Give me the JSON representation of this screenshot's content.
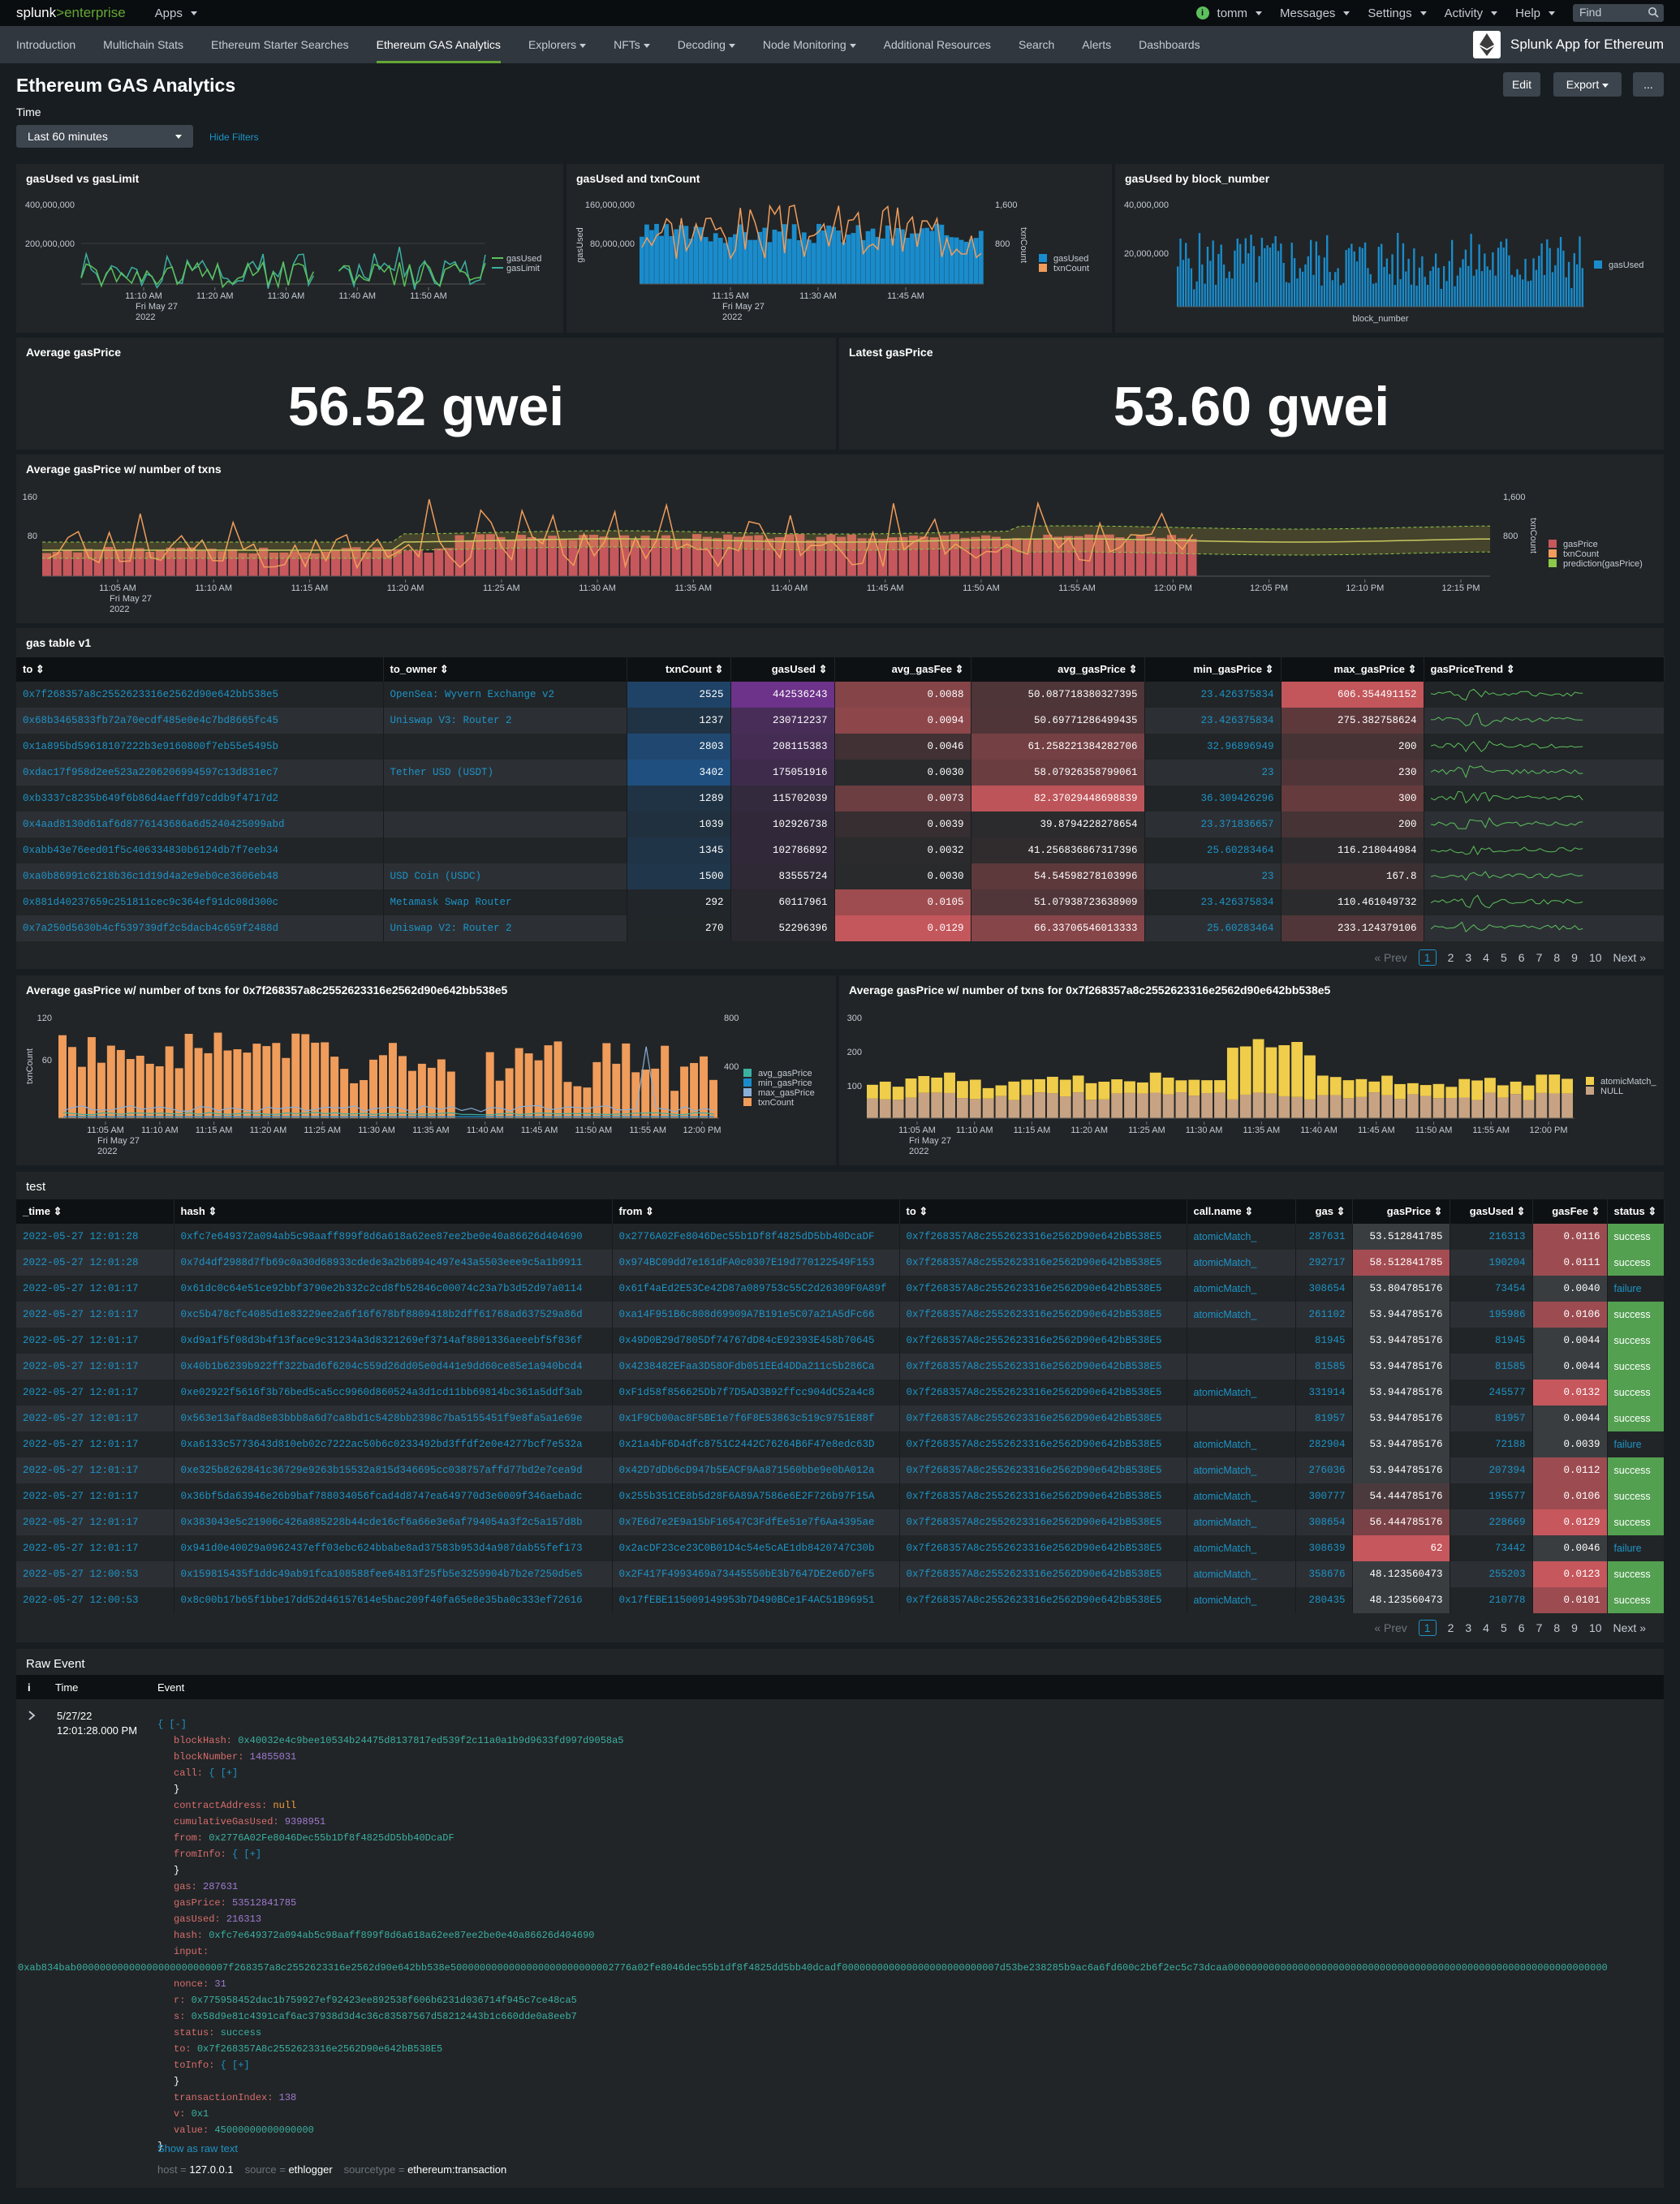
{
  "topbar": {
    "logo_a": "splunk",
    "logo_b": ">enterprise",
    "apps": "Apps",
    "user": "tomm",
    "messages": "Messages",
    "settings": "Settings",
    "activity": "Activity",
    "help": "Help",
    "find": "Find",
    "status_glyph": "i"
  },
  "nav": {
    "items": [
      "Introduction",
      "Multichain Stats",
      "Ethereum Starter Searches",
      "Ethereum GAS Analytics",
      "Explorers",
      "NFTs",
      "Decoding",
      "Node Monitoring",
      "Additional Resources",
      "Search",
      "Alerts",
      "Dashboards"
    ],
    "active": "Ethereum GAS Analytics",
    "dropdowns": [
      "Explorers",
      "NFTs",
      "Decoding",
      "Node Monitoring"
    ],
    "app_title": "Splunk App for Ethereum"
  },
  "header": {
    "title": "Ethereum GAS Analytics",
    "edit": "Edit",
    "export": "Export",
    "more": "...",
    "time_label": "Time",
    "time_value": "Last 60 minutes",
    "hide_filters": "Hide Filters"
  },
  "colors": {
    "blue": "#1a8ccc",
    "orange": "#f09c5b",
    "green": "#5cc05c",
    "yellow": "#f0cd4a",
    "tan": "#c7a383",
    "red": "#c6575c",
    "link": "#1e93c6",
    "success": "#53a051",
    "failure_text": "#1e93c6"
  },
  "panels": {
    "p1": {
      "title": "gasUsed vs gasLimit",
      "y_ticks": [
        "400,000,000",
        "200,000,000"
      ],
      "x_ticks": [
        "11:10 AM",
        "11:20 AM",
        "11:30 AM",
        "11:40 AM",
        "11:50 AM"
      ],
      "x_sub": [
        "Fri May 27",
        "2022"
      ],
      "legend": [
        "gasUsed",
        "gasLimit"
      ]
    },
    "p2": {
      "title": "gasUsed and txnCount",
      "y_ticks": [
        "160,000,000",
        "80,000,000"
      ],
      "y2_ticks": [
        "1,600",
        "800"
      ],
      "y_label": "gasUsed",
      "y2_label": "txnCount",
      "x_ticks": [
        "11:15 AM",
        "11:30 AM",
        "11:45 AM"
      ],
      "x_sub": [
        "Fri May 27",
        "2022"
      ],
      "legend": [
        "gasUsed",
        "txnCount"
      ]
    },
    "p3": {
      "title": "gasUsed by block_number",
      "y_ticks": [
        "40,000,000",
        "20,000,000"
      ],
      "x_label": "block_number",
      "legend": [
        "gasUsed"
      ]
    },
    "avg": {
      "title": "Average gasPrice",
      "value": "56.52 gwei"
    },
    "latest": {
      "title": "Latest gasPrice",
      "value": "53.60 gwei"
    },
    "p6": {
      "title": "Average gasPrice w/ number of txns",
      "y_ticks": [
        "160",
        "80"
      ],
      "y2_ticks": [
        "1,600",
        "800"
      ],
      "y2_label": "txnCount",
      "x_ticks": [
        "11:05 AM",
        "11:10 AM",
        "11:15 AM",
        "11:20 AM",
        "11:25 AM",
        "11:30 AM",
        "11:35 AM",
        "11:40 AM",
        "11:45 AM",
        "11:50 AM",
        "11:55 AM",
        "12:00 PM",
        "12:05 PM",
        "12:10 PM",
        "12:15 PM"
      ],
      "x_sub": [
        "Fri May 27",
        "2022"
      ],
      "legend": [
        "gasPrice",
        "txnCount",
        "prediction(gasPrice)"
      ]
    },
    "gastable": {
      "title": "gas table v1"
    },
    "p8": {
      "title": "Average gasPrice w/ number of txns for 0x7f268357a8c2552623316e2562d90e642bb538e5",
      "y_ticks": [
        "120",
        "60"
      ],
      "y2_ticks": [
        "800",
        "400"
      ],
      "y_label": "txnCount",
      "x_ticks": [
        "11:05 AM",
        "11:10 AM",
        "11:15 AM",
        "11:20 AM",
        "11:25 AM",
        "11:30 AM",
        "11:35 AM",
        "11:40 AM",
        "11:45 AM",
        "11:50 AM",
        "11:55 AM",
        "12:00 PM"
      ],
      "x_sub": [
        "Fri May 27",
        "2022"
      ],
      "legend": [
        "avg_gasPrice",
        "min_gasPrice",
        "max_gasPrice",
        "txnCount"
      ]
    },
    "p9": {
      "title": "Average gasPrice w/ number of txns for 0x7f268357a8c2552623316e2562d90e642bb538e5",
      "y_ticks": [
        "300",
        "200",
        "100"
      ],
      "x_ticks": [
        "11:05 AM",
        "11:10 AM",
        "11:15 AM",
        "11:20 AM",
        "11:25 AM",
        "11:30 AM",
        "11:35 AM",
        "11:40 AM",
        "11:45 AM",
        "11:50 AM",
        "11:55 AM",
        "12:00 PM"
      ],
      "x_sub": [
        "Fri May 27",
        "2022"
      ],
      "legend": [
        "atomicMatch_",
        "NULL"
      ]
    },
    "test": {
      "title": "test"
    },
    "raw": {
      "title": "Raw Event"
    }
  },
  "gas_table": {
    "columns": [
      "to",
      "to_owner",
      "txnCount",
      "gasUsed",
      "avg_gasFee",
      "avg_gasPrice",
      "min_gasPrice",
      "max_gasPrice",
      "gasPriceTrend"
    ],
    "rows": [
      [
        "0x7f268357a8c2552623316e2562d90e642bb538e5",
        "OpenSea: Wyvern Exchange v2",
        "2525",
        "442536243",
        "0.0088",
        "50.087718380327395",
        "23.426375834",
        "606.354491152"
      ],
      [
        "0x68b3465833fb72a70ecdf485e0e4c7bd8665fc45",
        "Uniswap V3: Router 2",
        "1237",
        "230712237",
        "0.0094",
        "50.69771286499435",
        "23.426375834",
        "275.382758624"
      ],
      [
        "0x1a895bd59618107222b3e9160800f7eb55e5495b",
        "",
        "2803",
        "208115383",
        "0.0046",
        "61.258221384282706",
        "32.96896949",
        "200"
      ],
      [
        "0xdac17f958d2ee523a2206206994597c13d831ec7",
        "Tether USD (USDT)",
        "3402",
        "175051916",
        "0.0030",
        "58.07926358799061",
        "23",
        "230"
      ],
      [
        "0xb3337c8235b649f6b86d4aeffd97cddb9f4717d2",
        "",
        "1289",
        "115702039",
        "0.0073",
        "82.37029448698839",
        "36.309426296",
        "300"
      ],
      [
        "0x4aad8130d61af6d8776143686a6d5240425099abd",
        "",
        "1039",
        "102926738",
        "0.0039",
        "39.8794228278654",
        "23.371836657",
        "200"
      ],
      [
        "0xabb43e76eed01f5c406334830b6124db7f7eeb34",
        "",
        "1345",
        "102786892",
        "0.0032",
        "41.256836867317396",
        "25.60283464",
        "116.218044984"
      ],
      [
        "0xa0b86991c6218b36c1d19d4a2e9eb0ce3606eb48",
        "USD Coin (USDC)",
        "1500",
        "83555724",
        "0.0030",
        "54.54598278103996",
        "23",
        "167.8"
      ],
      [
        "0x881d40237659c251811cec9c364ef91dc08d300c",
        "Metamask Swap Router",
        "292",
        "60117961",
        "0.0105",
        "51.07938723638909",
        "23.426375834",
        "110.461049732"
      ],
      [
        "0x7a250d5630b4cf539739df2c5dacb4c659f2488d",
        "Uniswap V2: Router 2",
        "270",
        "52296396",
        "0.0129",
        "66.33706546013333",
        "25.60283464",
        "233.124379106"
      ]
    ]
  },
  "pager": {
    "prev": "« Prev",
    "pages": [
      "1",
      "2",
      "3",
      "4",
      "5",
      "6",
      "7",
      "8",
      "9",
      "10"
    ],
    "next": "Next »"
  },
  "test_table": {
    "columns": [
      "_time",
      "hash",
      "from",
      "to",
      "call.name",
      "gas",
      "gasPrice",
      "gasUsed",
      "gasFee",
      "status"
    ],
    "rows": [
      [
        "2022-05-27 12:01:28",
        "0xfc7e649372a094ab5c98aaff899f8d6a618a62ee87ee2be0e40a86626d404690",
        "0x2776A02Fe8046Dec55b1Df8f4825dD5bb40DcaDF",
        "0x7f268357A8c2552623316e2562D90e642bB538E5",
        "atomicMatch_",
        "287631",
        "53.512841785",
        "216313",
        "0.0116",
        "success"
      ],
      [
        "2022-05-27 12:01:28",
        "0x7d4df2988d7fb69c0a30d68933cdede3a2b6894c497e43a5503eee9c5a1b9911",
        "0x974BC09dd7e161dFA0c0307E19d770122549F153",
        "0x7f268357A8c2552623316e2562D90e642bB538E5",
        "atomicMatch_",
        "292717",
        "58.512841785",
        "190204",
        "0.0111",
        "success"
      ],
      [
        "2022-05-27 12:01:17",
        "0x61dc0c64e51ce92bbf3790e2b332c2cd8fb52846c00074c23a7b3d52d97a0114",
        "0x61f4aEd2E53Ce42D87a089753c55C2d26309F0A89f",
        "0x7f268357A8c2552623316e2562D90e642bB538E5",
        "atomicMatch_",
        "308654",
        "53.804785176",
        "73454",
        "0.0040",
        "failure"
      ],
      [
        "2022-05-27 12:01:17",
        "0xc5b478cfc4085d1e83229ee2a6f16f678bf8809418b2dff61768ad637529a86d",
        "0xa14F951B6c808d69909A7B191e5C07a21A5dFc66",
        "0x7f268357A8c2552623316e2562D90e642bB538E5",
        "atomicMatch_",
        "261102",
        "53.944785176",
        "195986",
        "0.0106",
        "success"
      ],
      [
        "2022-05-27 12:01:17",
        "0xd9a1f5f08d3b4f13face9c31234a3d8321269ef3714af8801336aeeebf5f836f",
        "0x49D0B29d7805Df74767dD84cE92393E458b70645",
        "0x7f268357A8c2552623316e2562D90e642bB538E5",
        "",
        "81945",
        "53.944785176",
        "81945",
        "0.0044",
        "success"
      ],
      [
        "2022-05-27 12:01:17",
        "0x40b1b6239b922ff322bad6f6204c559d26dd05e0d441e9dd60ce85e1a940bcd4",
        "0x4238482EFaa3D58OFdb051EEd4DDa211c5b286Ca",
        "0x7f268357A8c2552623316e2562D90e642bB538E5",
        "",
        "81585",
        "53.944785176",
        "81585",
        "0.0044",
        "success"
      ],
      [
        "2022-05-27 12:01:17",
        "0xe02922f5616f3b76bed5ca5cc9960d860524a3d1cd11bb69814bc361a5ddf3ab",
        "0xF1d58f856625Db7f7D5AD3B92ffcc904dC52a4c8",
        "0x7f268357A8c2552623316e2562D90e642bB538E5",
        "atomicMatch_",
        "331914",
        "53.944785176",
        "245577",
        "0.0132",
        "success"
      ],
      [
        "2022-05-27 12:01:17",
        "0x563e13af8ad8e83bbb8a6d7ca8bd1c5428bb2398c7ba5155451f9e8fa5a1e69e",
        "0x1F9Cb00ac8F5BE1e7f6F8E53863c519c9751E88f",
        "0x7f268357A8c2552623316e2562D90e642bB538E5",
        "",
        "81957",
        "53.944785176",
        "81957",
        "0.0044",
        "success"
      ],
      [
        "2022-05-27 12:01:17",
        "0xa6133c5773643d810eb02c7222ac50b6c0233492bd3ffdf2e0e4277bcf7e532a",
        "0x21a4bF6D4dfc8751C2442C76264B6F47e8edc63D",
        "0x7f268357A8c2552623316e2562D90e642bB538E5",
        "atomicMatch_",
        "282904",
        "53.944785176",
        "72188",
        "0.0039",
        "failure"
      ],
      [
        "2022-05-27 12:01:17",
        "0xe325b8262841c36729e9263b15532a815d346695cc038757affd77bd2e7cea9d",
        "0x42D7dDb6cD947b5EACF9Aa871560bbe9e0bA012a",
        "0x7f268357A8c2552623316e2562D90e642bB538E5",
        "atomicMatch_",
        "276036",
        "53.944785176",
        "207394",
        "0.0112",
        "success"
      ],
      [
        "2022-05-27 12:01:17",
        "0x36bf5da63946e26b9baf788034056fcad4d8747ea649770d3e0009f346aebadc",
        "0x255b351CE8b5d28F6A89A7586e6E2F726b97F15A",
        "0x7f268357A8c2552623316e2562D90e642bB538E5",
        "atomicMatch_",
        "300777",
        "54.444785176",
        "195577",
        "0.0106",
        "success"
      ],
      [
        "2022-05-27 12:01:17",
        "0x383043e5c21906c426a885228b44cde16cf6a66e3e6af794054a3f2c5a157d8b",
        "0x7E6d7e2E9a15bF16547C3FdfEe51e7f6Aa4395ae",
        "0x7f268357A8c2552623316e2562D90e642bB538E5",
        "atomicMatch_",
        "308654",
        "56.444785176",
        "228669",
        "0.0129",
        "success"
      ],
      [
        "2022-05-27 12:01:17",
        "0x941d0e40029a0962437eff03ebc624bbabe8ad37583b953d4a987dab55fef173",
        "0x2acDF23ce23C0B01D4c54e5cAE1db8420747C30b",
        "0x7f268357A8c2552623316e2562D90e642bB538E5",
        "atomicMatch_",
        "308639",
        "62",
        "73442",
        "0.0046",
        "failure"
      ],
      [
        "2022-05-27 12:00:53",
        "0x159815435f1ddc49ab91fca108588fee64813f25fb5e3259904b7b2e7250d5e5",
        "0x2F417F4993469a73445550bE3b7647DE2e6D7eF5",
        "0x7f268357A8c2552623316e2562D90e642bB538E5",
        "atomicMatch_",
        "358676",
        "48.123560473",
        "255203",
        "0.0123",
        "success"
      ],
      [
        "2022-05-27 12:00:53",
        "0x8c00b17b65f1bbe17dd52d46157614e5bac209f40fa65e8e35ba0c333ef72616",
        "0x17fEBE115009149953b7D490BCe1F4AC51B96951",
        "0x7f268357A8c2552623316e2562D90e642bB538E5",
        "atomicMatch_",
        "280435",
        "48.123560473",
        "210778",
        "0.0101",
        "success"
      ]
    ]
  },
  "raw": {
    "col_i": "i",
    "col_time": "Time",
    "col_event": "Event",
    "date": "5/27/22",
    "time": "12:01:28.000 PM",
    "lines": [
      {
        "k": "",
        "v": "{ [-]",
        "c": "plain"
      },
      {
        "k": "blockHash: ",
        "v": "0x40032e4c9bee10534b24475d8137817ed539f2c11a0a1b9d9633fd997d9058a5",
        "c": "str"
      },
      {
        "k": "blockNumber: ",
        "v": "14855031",
        "c": "num"
      },
      {
        "k": "call: ",
        "v": "{ [+]",
        "c": "plain"
      },
      {
        "k": "",
        "v": "}",
        "c": "plain"
      },
      {
        "k": "contractAddress: ",
        "v": "null",
        "c": "null"
      },
      {
        "k": "cumulativeGasUsed: ",
        "v": "9398951",
        "c": "num"
      },
      {
        "k": "from: ",
        "v": "0x2776A02Fe8046Dec55b1Df8f4825dD5bb40DcaDF",
        "c": "str"
      },
      {
        "k": "fromInfo: ",
        "v": "{ [+]",
        "c": "plain"
      },
      {
        "k": "",
        "v": "}",
        "c": "plain"
      },
      {
        "k": "gas: ",
        "v": "287631",
        "c": "num"
      },
      {
        "k": "gasPrice: ",
        "v": "53512841785",
        "c": "num"
      },
      {
        "k": "gasUsed: ",
        "v": "216313",
        "c": "num"
      },
      {
        "k": "hash: ",
        "v": "0xfc7e649372a094ab5c98aaff899f8d6a618a62ee87ee2be0e40a86626d404690",
        "c": "str"
      },
      {
        "k": "input: ",
        "v": "",
        "c": "plain"
      },
      {
        "k": "",
        "v": "0xab834bab00000000000000000000000007f268357a8c2552623316e2562d90e642bb538e5000000000000000000000000002776a02fe8046dec55b1df8f4825dd5bb40dcadf000000000000000000000000007d53be238285b9ac6a6fd600c2b6f2ec5c73dcaa00000000000000000000000000000000000000000000000000000000000000000",
        "c": "strfull"
      },
      {
        "k": "nonce: ",
        "v": "31",
        "c": "num"
      },
      {
        "k": "r: ",
        "v": "0x775958452dac1b759927ef92423ee892538f606b6231d036714f945c7ce48ca5",
        "c": "str"
      },
      {
        "k": "s: ",
        "v": "0x58d9e81c4391caf6ac37938d3d4c36c83587567d58212443b1c660dde0a8eeb7",
        "c": "str"
      },
      {
        "k": "status: ",
        "v": "success",
        "c": "str"
      },
      {
        "k": "to: ",
        "v": "0x7f268357A8c2552623316e2562D90e642bB538E5",
        "c": "str"
      },
      {
        "k": "toInfo: ",
        "v": "{ [+]",
        "c": "plain"
      },
      {
        "k": "",
        "v": "}",
        "c": "plain"
      },
      {
        "k": "transactionIndex: ",
        "v": "138",
        "c": "num"
      },
      {
        "k": "v: ",
        "v": "0x1",
        "c": "str"
      },
      {
        "k": "value: ",
        "v": "45000000000000000",
        "c": "str"
      },
      {
        "k": "",
        "v": "}",
        "c": "close"
      }
    ],
    "show_raw": "Show as raw text",
    "meta": [
      {
        "k": "host = ",
        "v": "127.0.0.1"
      },
      {
        "k": "source = ",
        "v": "ethlogger"
      },
      {
        "k": "sourcetype = ",
        "v": "ethereum:transaction"
      }
    ]
  }
}
